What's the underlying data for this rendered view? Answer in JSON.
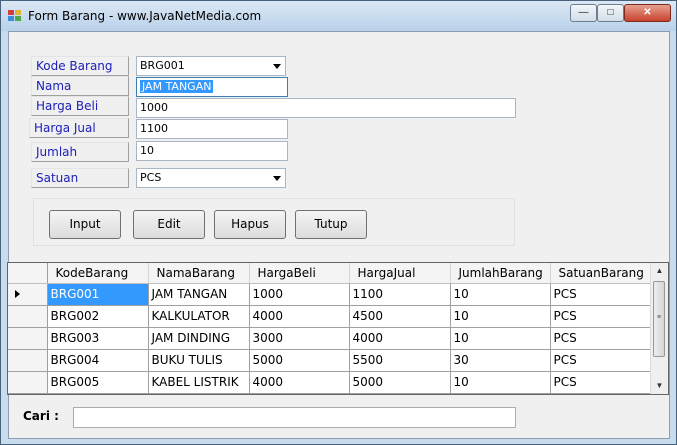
{
  "window": {
    "title": "Form Barang - www.JavaNetMedia.com",
    "controls": {
      "minimize": "—",
      "maximize": "□",
      "close": "✕"
    }
  },
  "form": {
    "kode_barang": {
      "label": "Kode Barang",
      "value": "BRG001"
    },
    "nama": {
      "label": "Nama",
      "value": "JAM TANGAN"
    },
    "harga_beli": {
      "label": "Harga Beli",
      "value": "1000"
    },
    "harga_jual": {
      "label": "Harga Jual",
      "value": "1100"
    },
    "jumlah": {
      "label": "Jumlah",
      "value": "10"
    },
    "satuan": {
      "label": "Satuan",
      "value": "PCS"
    }
  },
  "buttons": {
    "input": "Input",
    "edit": "Edit",
    "hapus": "Hapus",
    "tutup": "Tutup"
  },
  "grid": {
    "columns": [
      "KodeBarang",
      "NamaBarang",
      "HargaBeli",
      "HargaJual",
      "JumlahBarang",
      "SatuanBarang"
    ],
    "rows": [
      [
        "BRG001",
        "JAM TANGAN",
        "1000",
        "1100",
        "10",
        "PCS"
      ],
      [
        "BRG002",
        "KALKULATOR",
        "4000",
        "4500",
        "10",
        "PCS"
      ],
      [
        "BRG003",
        "JAM DINDING",
        "3000",
        "4000",
        "10",
        "PCS"
      ],
      [
        "BRG004",
        "BUKU TULIS",
        "5000",
        "5500",
        "30",
        "PCS"
      ],
      [
        "BRG005",
        "KABEL LISTRIK",
        "4000",
        "5000",
        "10",
        "PCS"
      ]
    ],
    "current_row": 0
  },
  "search": {
    "label": "Cari  :",
    "value": ""
  },
  "colors": {
    "selection": "#3399ff",
    "label_text": "#1e20b8"
  }
}
